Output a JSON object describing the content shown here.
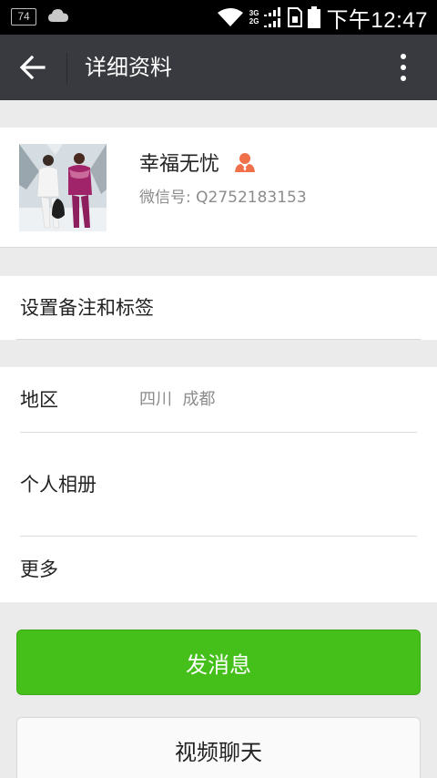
{
  "status_bar": {
    "battery_level": "74",
    "network_top": "3G",
    "network_bottom": "2G",
    "time": "下午12:47"
  },
  "titlebar": {
    "title": "详细资料",
    "back_icon": "arrow-left-icon",
    "more_icon": "more-vertical-icon"
  },
  "profile": {
    "name": "幸福无忧",
    "wechat_id": "微信号: Q2752183153",
    "badge_icon": "person-icon",
    "badge_color": "#f0704a"
  },
  "remark": {
    "label": "设置备注和标签"
  },
  "info": {
    "region_label": "地区",
    "region_value": "四川  成都",
    "album_label": "个人相册",
    "more_label": "更多"
  },
  "actions": {
    "send_message": "发消息",
    "video_chat": "视频聊天"
  },
  "colors": {
    "titlebar_bg": "#393a3f",
    "primary_green": "#45c01a",
    "page_bg": "#ebebeb"
  }
}
